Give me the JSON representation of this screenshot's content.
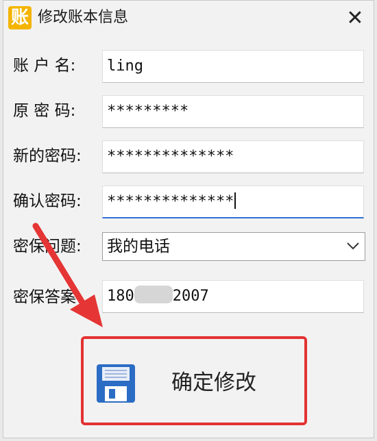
{
  "window": {
    "title": "修改账本信息",
    "icon_char": "账",
    "close_glyph": "✕"
  },
  "form": {
    "account_name": {
      "label": "账 户 名:",
      "value": "ling"
    },
    "old_password": {
      "label": "原 密 码:",
      "value": "*********"
    },
    "new_password": {
      "label": "新的密码:",
      "value": "**************"
    },
    "confirm_password": {
      "label": "确认密码:",
      "value": "**************"
    },
    "security_question": {
      "label": "密保问题:",
      "selected": "我的电话"
    },
    "security_answer": {
      "label": "密保答案",
      "value_start": "180",
      "value_end": "2007"
    }
  },
  "confirm_button": {
    "label": "确定修改"
  },
  "colors": {
    "highlight": "#e33232",
    "focus": "#2f6fd6",
    "app_icon": "#f4b400"
  }
}
